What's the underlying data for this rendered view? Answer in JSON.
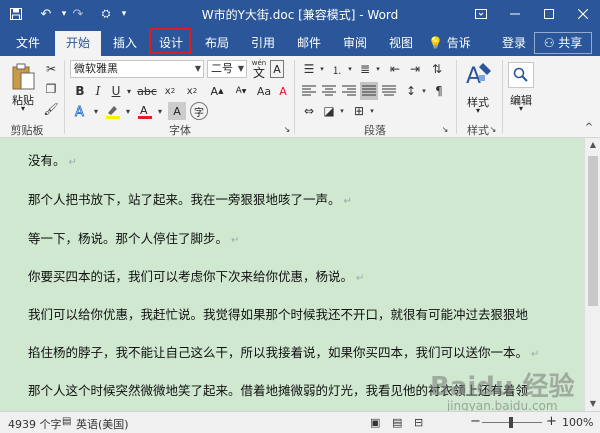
{
  "titlebar": {
    "title": "W市的Y大街.doc [兼容模式] - Word",
    "save_icon": "save-icon",
    "undo_icon": "undo-icon",
    "redo_icon": "redo-icon",
    "customize_icon": "customize-icon"
  },
  "tabs": [
    {
      "label": "文件"
    },
    {
      "label": "开始"
    },
    {
      "label": "插入"
    },
    {
      "label": "设计"
    },
    {
      "label": "布局"
    },
    {
      "label": "引用"
    },
    {
      "label": "邮件"
    },
    {
      "label": "审阅"
    },
    {
      "label": "视图"
    }
  ],
  "tellme": "告诉我...",
  "login": "登录",
  "share": "共享",
  "ribbon": {
    "clipboard": {
      "paste": "粘贴",
      "label": "剪贴板"
    },
    "font": {
      "name": "微软雅黑",
      "size": "二号",
      "label": "字体",
      "wen": "wén",
      "wen_char": "文"
    },
    "paragraph": {
      "label": "段落"
    },
    "styles": {
      "label": "样式",
      "group": "样式"
    },
    "editing": {
      "label": "编辑"
    }
  },
  "document": {
    "paragraphs": [
      "没有。",
      "那个人把书放下，站了起来。我在一旁狠狠地咳了一声。",
      "等一下，杨说。那个人停住了脚步。",
      "你要买四本的话，我们可以考虑你下次来给你优惠，杨说。",
      "我们可以给你优惠，我赶忙说。我觉得如果那个时候我还不开口，就很有可能冲过去狠狠地",
      "掐住杨的脖子，我不能让自己这么干，所以我接着说，如果你买四本，我们可以送你一本。",
      "那个人这个时候突然微微地笑了起来。借着地摊微弱的灯光，我看见他的衬衣领上还有着领"
    ],
    "para_mark": "↵"
  },
  "statusbar": {
    "word_count": "4939 个字",
    "language": "英语(美国)",
    "zoom": "100%",
    "zoom_minus": "−",
    "zoom_plus": "+"
  },
  "watermark": {
    "text": "Baidu 经验",
    "sub": "jingyan.baidu.com"
  },
  "colors": {
    "accent": "#2b579a",
    "page_bg": "#cfe8cf",
    "highlight_red": "#e01b1b"
  }
}
